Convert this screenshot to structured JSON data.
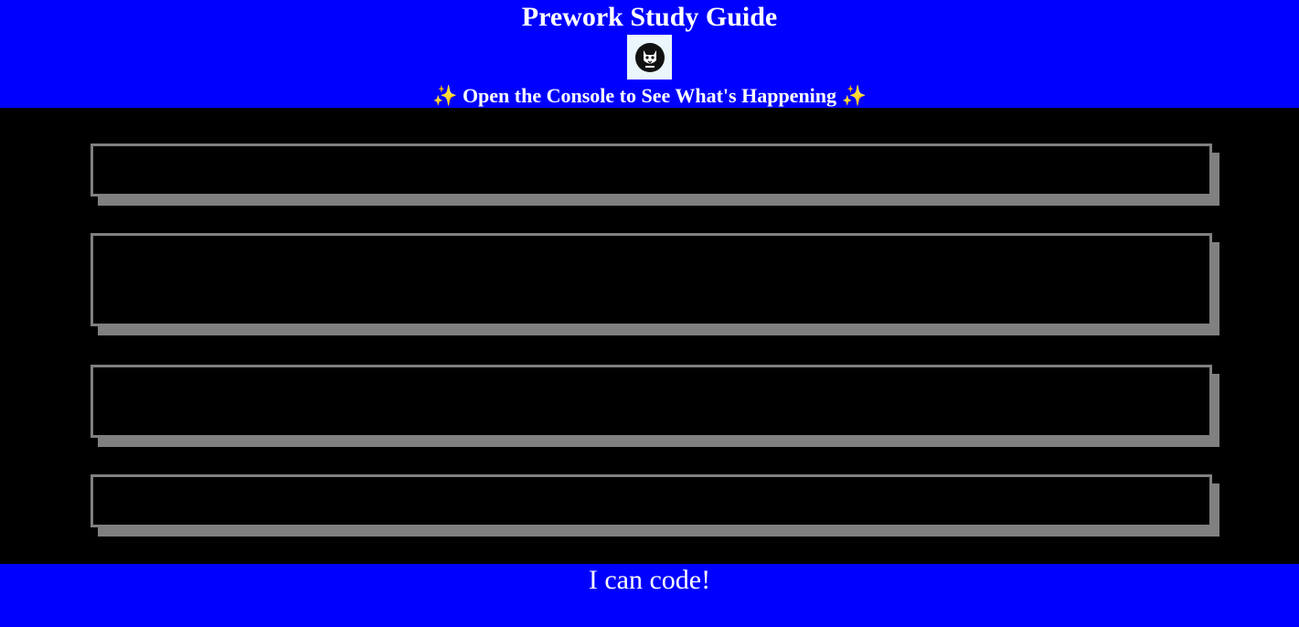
{
  "header": {
    "title": "Prework Study Guide",
    "logo_icon": "cat-mask-icon",
    "subtitle_text": "Open the Console to See What's Happening",
    "sparkle": "✨"
  },
  "main": {
    "topic_boxes": [
      "",
      "",
      "",
      ""
    ]
  },
  "footer": {
    "text": "I can code!"
  },
  "colors": {
    "header_bg": "#0000ff",
    "main_bg": "#000000",
    "box_border": "#808080",
    "text": "#ffffff",
    "logo_bg": "#eaf6fb"
  }
}
